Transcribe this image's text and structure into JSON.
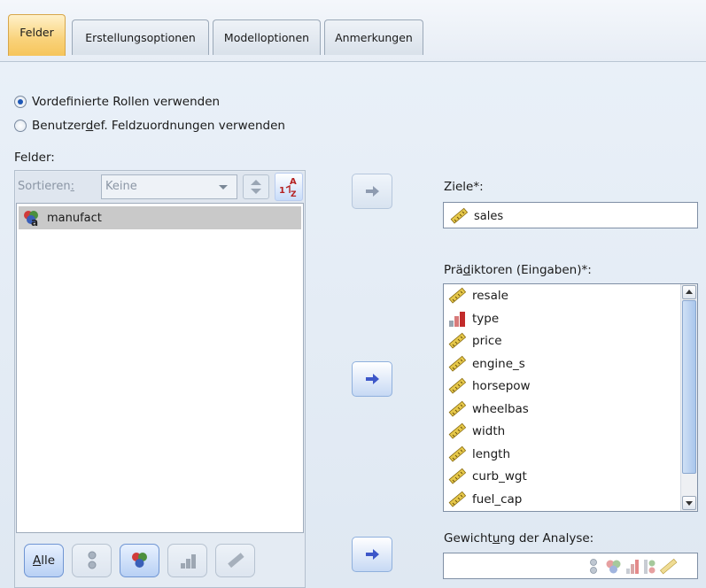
{
  "tabs": [
    {
      "label": "Felder",
      "active": true
    },
    {
      "label": "Erstellungsoptionen",
      "active": false
    },
    {
      "label": "Modelloptionen",
      "active": false
    },
    {
      "label": "Anmerkungen",
      "active": false
    }
  ],
  "roles": {
    "predefined": {
      "label": "Vordefinierte Rollen verwenden",
      "checked": true
    },
    "custom": {
      "pre": "Benutzer",
      "accel": "d",
      "post": "ef. Feldzuordnungen verwenden",
      "checked": false
    }
  },
  "fields": {
    "title": "Felder:",
    "sort_label_pre": "Sortieren",
    "sort_label_accel": ":",
    "sort_value": "Keine",
    "items": [
      "manufact"
    ],
    "filter_all_label_accel": "A",
    "filter_all_label_rest": "lle"
  },
  "targets": {
    "title": "Ziele*:",
    "items": [
      "sales"
    ]
  },
  "predictors": {
    "title_pre": "Prä",
    "title_accel": "d",
    "title_post": "iktoren (Eingaben)*:",
    "items": [
      {
        "name": "resale",
        "icon": "ruler-icon"
      },
      {
        "name": "type",
        "icon": "bar-chart-icon"
      },
      {
        "name": "price",
        "icon": "ruler-icon"
      },
      {
        "name": "engine_s",
        "icon": "ruler-icon"
      },
      {
        "name": "horsepow",
        "icon": "ruler-icon"
      },
      {
        "name": "wheelbas",
        "icon": "ruler-icon"
      },
      {
        "name": "width",
        "icon": "ruler-icon"
      },
      {
        "name": "length",
        "icon": "ruler-icon"
      },
      {
        "name": "curb_wgt",
        "icon": "ruler-icon"
      },
      {
        "name": "fuel_cap",
        "icon": "ruler-icon"
      }
    ]
  },
  "weight": {
    "title_pre": "Gewicht",
    "title_accel": "u",
    "title_post": "ng der Analyse:"
  },
  "colors": {
    "active_tab": "#f6c55b",
    "selection": "#c9c9c9",
    "accent_arrow": "#3d57c9"
  }
}
